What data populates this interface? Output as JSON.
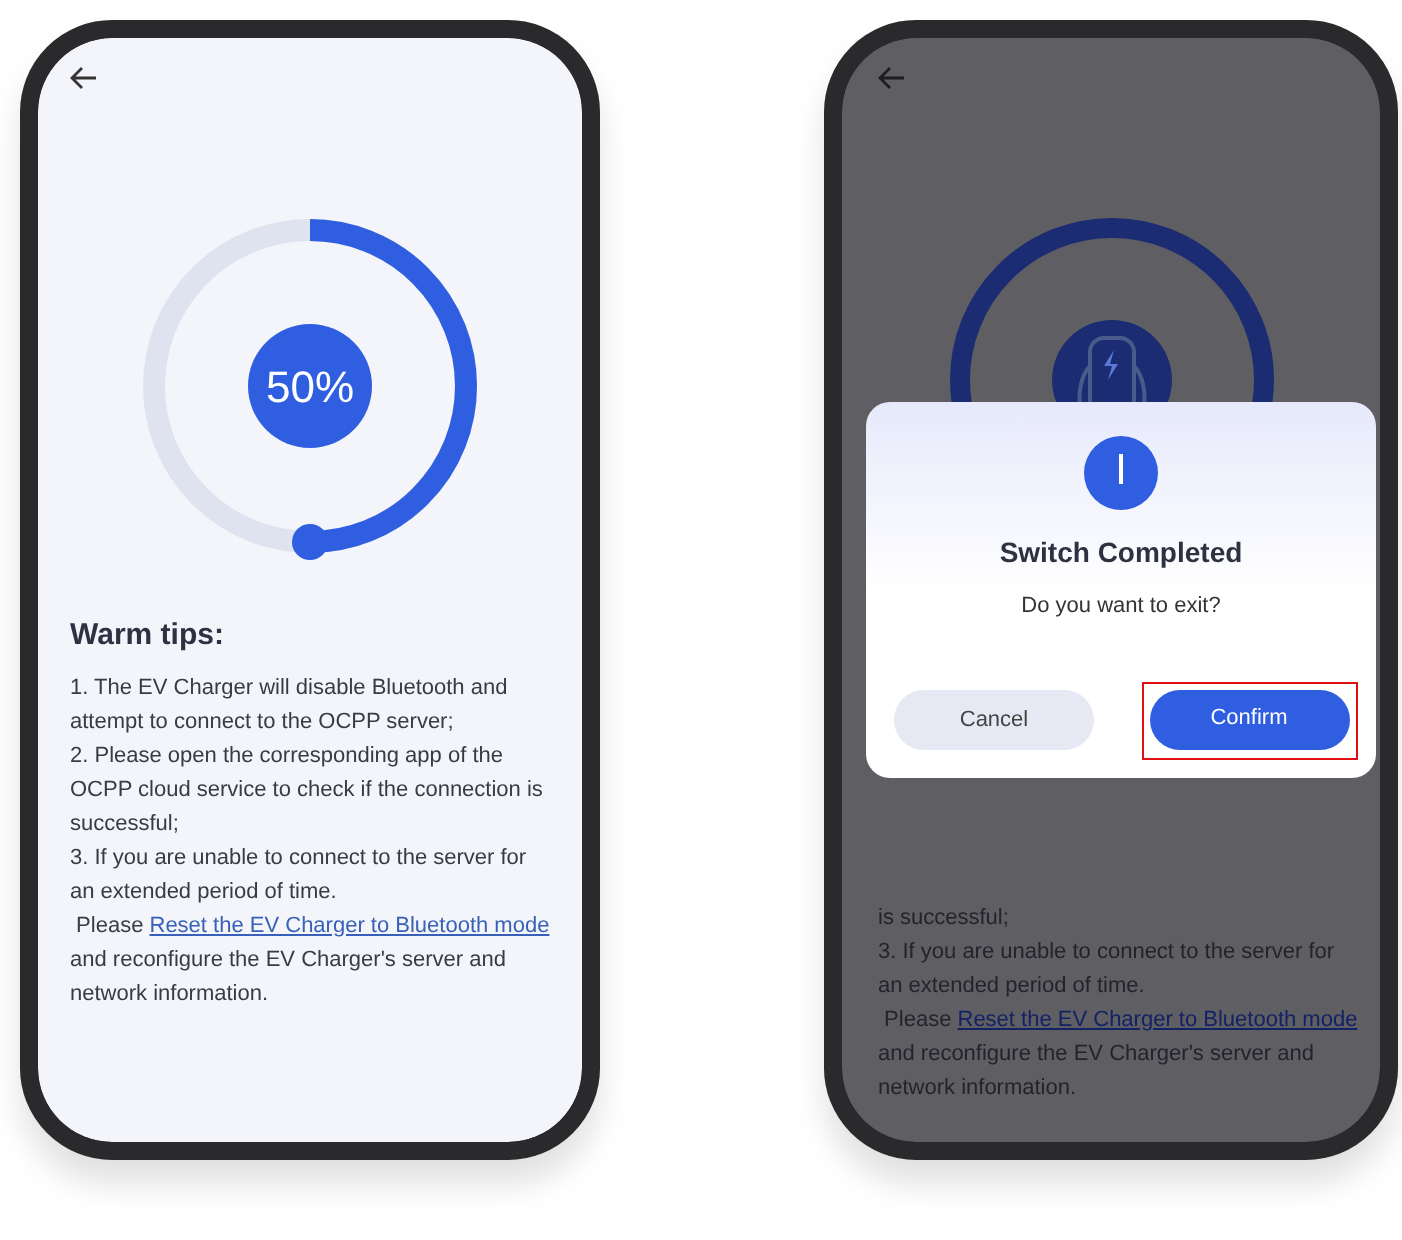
{
  "left_screen": {
    "progress": {
      "level": 0.5,
      "label": "50%"
    },
    "tips_title": "Warm tips:",
    "tips": [
      "1. The EV Charger will disable Bluetooth and attempt to connect to the OCPP server;",
      "2. Please open the corresponding app of the OCPP cloud service to check if the connection is successful;",
      "3. If you are unable to connect to the server for an extended period of time."
    ],
    "reset_note": {
      "before": " Please ",
      "link": "Reset the EV Charger to Bluetooth mode",
      "after": " and reconfigure the EV Charger's server and network information."
    }
  },
  "right_screen": {
    "dimmed": true,
    "tips": [
      "is successful;",
      "3. If you are unable to connect to the server for an extended period of time."
    ],
    "reset_note": {
      "before": " Please ",
      "link": "Reset the EV Charger to Bluetooth mode",
      "after": " and reconfigure the EV Charger's server and network information."
    },
    "dialog": {
      "title": "Switch Completed",
      "message": "Do you want to exit?",
      "buttons": [
        {
          "label": "Cancel",
          "kind": "secondary",
          "highlighted": false
        },
        {
          "label": "Confirm",
          "kind": "primary",
          "highlighted": true
        }
      ]
    }
  }
}
